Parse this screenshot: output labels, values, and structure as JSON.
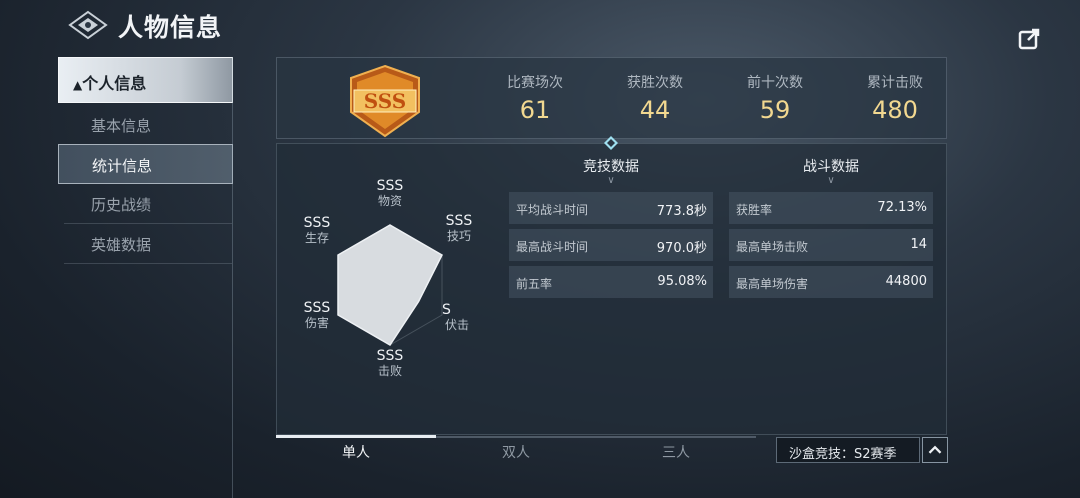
{
  "header": {
    "title": "人物信息",
    "logo_icon": "emblem-icon",
    "share_icon": "share-icon"
  },
  "sidebar": {
    "items": [
      {
        "label": "个人信息",
        "icon": "chevron-up-icon",
        "state": "expanded"
      },
      {
        "label": "基本信息",
        "state": "normal"
      },
      {
        "label": "统计信息",
        "state": "selected"
      },
      {
        "label": "历史战绩",
        "state": "normal"
      },
      {
        "label": "英雄数据",
        "state": "normal"
      }
    ]
  },
  "rank": {
    "badge_icon": "sss-rank-badge-icon",
    "badge_text": "SSS"
  },
  "stats": [
    {
      "label": "比赛场次",
      "value": "61"
    },
    {
      "label": "获胜次数",
      "value": "44"
    },
    {
      "label": "前十次数",
      "value": "59"
    },
    {
      "label": "累计击败",
      "value": "480"
    }
  ],
  "radar": {
    "axes": [
      {
        "grade": "SSS",
        "name": "物资"
      },
      {
        "grade": "SSS",
        "name": "技巧"
      },
      {
        "grade": "S",
        "name": "伏击"
      },
      {
        "grade": "SSS",
        "name": "击败"
      },
      {
        "grade": "SSS",
        "name": "伤害"
      },
      {
        "grade": "SSS",
        "name": "生存"
      }
    ],
    "levels": [
      1.0,
      1.0,
      0.55,
      1.0,
      1.0,
      1.0
    ]
  },
  "competitive": {
    "title": "竞技数据",
    "rows": [
      {
        "label": "平均战斗时间",
        "value": "773.8秒"
      },
      {
        "label": "最高战斗时间",
        "value": "970.0秒"
      },
      {
        "label": "前五率",
        "value": "95.08%"
      }
    ]
  },
  "combat": {
    "title": "战斗数据",
    "rows": [
      {
        "label": "获胜率",
        "value": "72.13%"
      },
      {
        "label": "最高单场击败",
        "value": "14"
      },
      {
        "label": "最高单场伤害",
        "value": "44800"
      }
    ]
  },
  "tabs": [
    {
      "label": "单人",
      "active": true
    },
    {
      "label": "双人",
      "active": false
    },
    {
      "label": "三人",
      "active": false
    }
  ],
  "season": {
    "label": "沙盒竞技：S2赛季",
    "button_icon": "chevron-up-icon"
  },
  "colors": {
    "accent_gold": "#f2d890",
    "badge_orange": "#e08a28"
  }
}
